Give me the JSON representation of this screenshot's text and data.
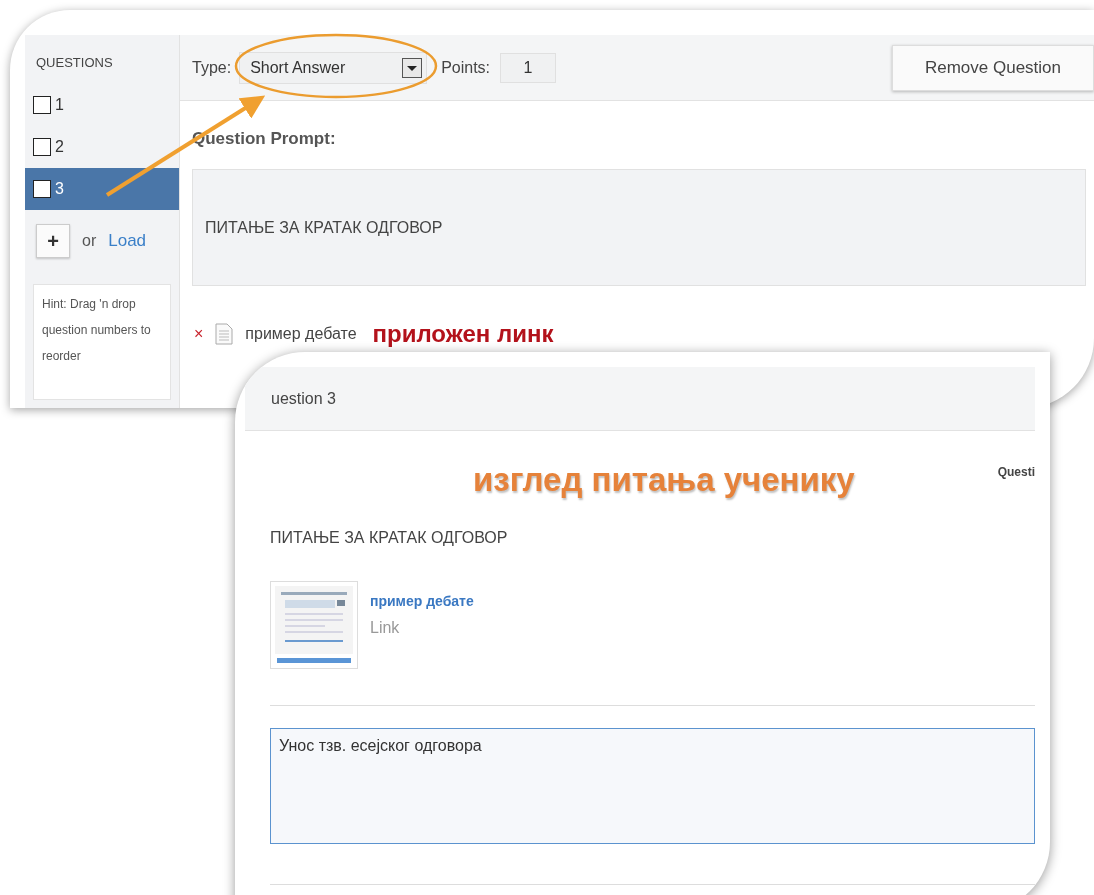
{
  "editor": {
    "sidebar": {
      "title": "QUESTIONS",
      "items": [
        {
          "label": "1",
          "selected": false,
          "checked": false
        },
        {
          "label": "2",
          "selected": false,
          "checked": false
        },
        {
          "label": "3",
          "selected": true,
          "checked": false
        }
      ],
      "add_button": "+",
      "or_text": "or",
      "load_link": "Load",
      "hint": "Hint: Drag 'n drop question numbers to reorder"
    },
    "toolbar": {
      "type_label": "Type:",
      "type_value": "Short Answer",
      "points_label": "Points:",
      "points_value": "1",
      "remove_button": "Remove Question"
    },
    "prompt_label": "Question Prompt:",
    "prompt_text": "ПИТАЊЕ ЗА КРАТАК ОДГОВОР",
    "attachment": {
      "remove_icon": "×",
      "name": "пример дебате"
    },
    "annotation": "приложен линк"
  },
  "preview": {
    "title": "uestion 3",
    "annotation": "изглед питања ученику",
    "side_label": "Questi",
    "prompt_text": "ПИТАЊЕ ЗА КРАТАК ОДГОВОР",
    "attachment": {
      "title": "пример дебате",
      "kind_label": "Link"
    },
    "answer_value": "Унос тзв. есејског одговора"
  }
}
